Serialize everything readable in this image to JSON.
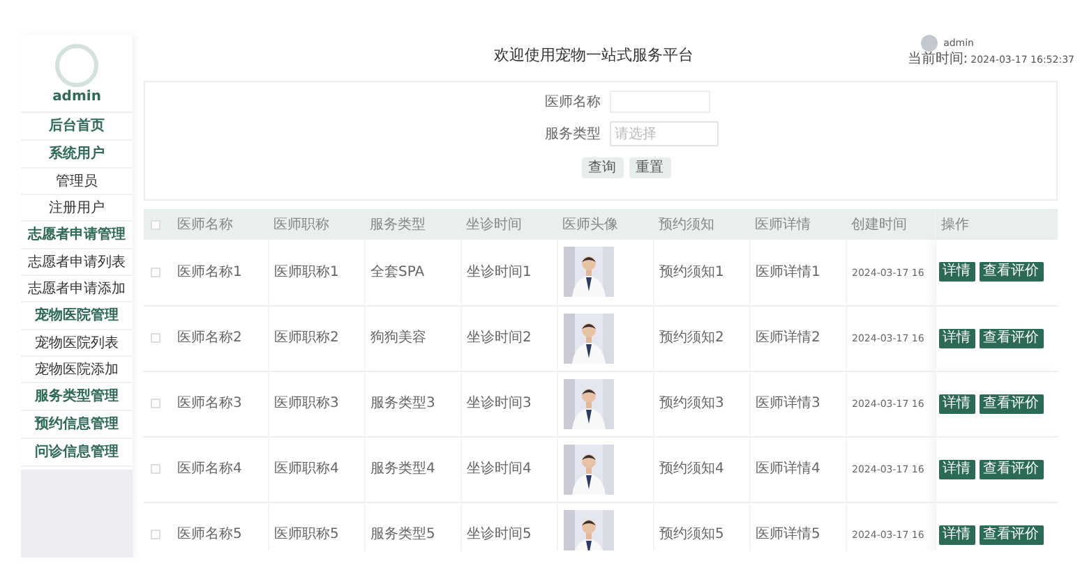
{
  "sidebar": {
    "user": "admin",
    "items": [
      {
        "label": "后台首页",
        "kind": "group",
        "selected": false
      },
      {
        "label": "系统用户",
        "kind": "group",
        "selected": false
      },
      {
        "label": "管理员",
        "kind": "sub",
        "selected": false
      },
      {
        "label": "注册用户",
        "kind": "sub",
        "selected": false
      },
      {
        "label": "志愿者申请管理",
        "kind": "group",
        "selected": false
      },
      {
        "label": "志愿者申请列表",
        "kind": "sub",
        "selected": false
      },
      {
        "label": "志愿者申请添加",
        "kind": "sub",
        "selected": false
      },
      {
        "label": "宠物医院管理",
        "kind": "group",
        "selected": false
      },
      {
        "label": "宠物医院列表",
        "kind": "sub",
        "selected": false
      },
      {
        "label": "宠物医院添加",
        "kind": "sub",
        "selected": false
      },
      {
        "label": "服务类型管理",
        "kind": "group",
        "selected": false
      },
      {
        "label": "预约信息管理",
        "kind": "group",
        "selected": false
      },
      {
        "label": "问诊信息管理",
        "kind": "group",
        "selected": false
      }
    ]
  },
  "header": {
    "title": "欢迎使用宠物一站式服务平台",
    "user": "admin",
    "time_label": "当前时间:",
    "time": "2024-03-17 16:52:37"
  },
  "search": {
    "fields": [
      {
        "label": "医师名称",
        "kind": "input"
      },
      {
        "label": "服务类型",
        "kind": "select",
        "placeholder": "请选择"
      }
    ],
    "buttons": [
      "查询",
      "重置"
    ]
  },
  "table": {
    "columns": [
      "医师名称",
      "医师职称",
      "服务类型",
      "坐诊时间",
      "医师头像",
      "预约须知",
      "医师详情",
      "创建时间",
      "操作"
    ],
    "all_selected": false,
    "rows": [
      {
        "selected": false,
        "cells": [
          "医师名称1",
          "医师职称1",
          "全套SPA",
          "坐诊时间1",
          "",
          "预约须知1",
          "医师详情1",
          "2024-03-17 16"
        ],
        "actions": [
          "详情",
          "查看评价"
        ]
      },
      {
        "selected": false,
        "cells": [
          "医师名称2",
          "医师职称2",
          "狗狗美容",
          "坐诊时间2",
          "",
          "预约须知2",
          "医师详情2",
          "2024-03-17 16"
        ],
        "actions": [
          "详情",
          "查看评价"
        ]
      },
      {
        "selected": false,
        "cells": [
          "医师名称3",
          "医师职称3",
          "服务类型3",
          "坐诊时间3",
          "",
          "预约须知3",
          "医师详情3",
          "2024-03-17 16"
        ],
        "actions": [
          "详情",
          "查看评价"
        ]
      },
      {
        "selected": false,
        "cells": [
          "医师名称4",
          "医师职称4",
          "服务类型4",
          "坐诊时间4",
          "",
          "预约须知4",
          "医师详情4",
          "2024-03-17 16"
        ],
        "actions": [
          "详情",
          "查看评价"
        ]
      },
      {
        "selected": false,
        "cells": [
          "医师名称5",
          "医师职称5",
          "服务类型5",
          "坐诊时间5",
          "",
          "预约须知5",
          "医师详情5",
          "2024-03-17 16"
        ],
        "actions": [
          "详情",
          "查看评价"
        ]
      }
    ]
  }
}
